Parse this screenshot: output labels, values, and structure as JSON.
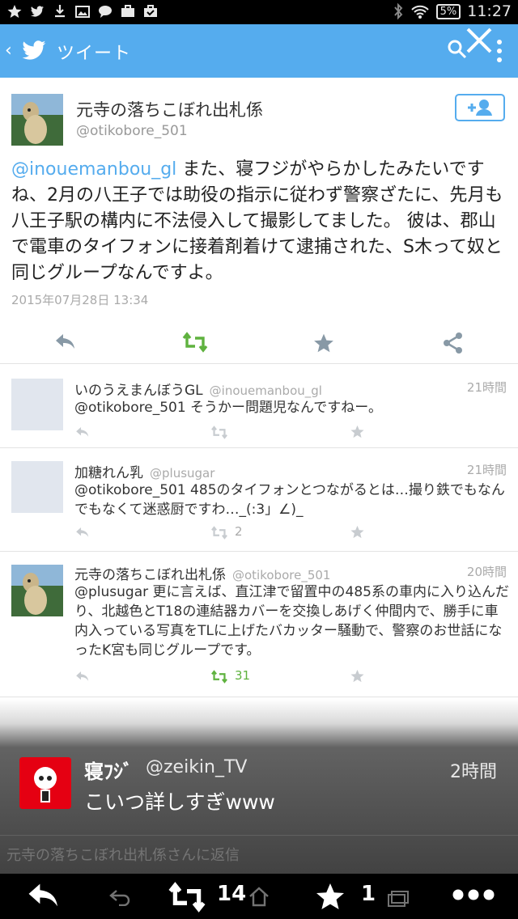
{
  "status_bar": {
    "battery": "5%",
    "time": "11:27",
    "left_icons": [
      "star-icon",
      "twitter-icon",
      "download-icon",
      "image-icon",
      "chat-icon",
      "briefcase-icon",
      "briefcase-check-icon"
    ],
    "right_icons": [
      "bluetooth-icon",
      "wifi-icon",
      "battery-icon"
    ]
  },
  "header": {
    "title": "ツイート",
    "color": "#55acee"
  },
  "main_tweet": {
    "name": "元寺の落ちこぼれ出札係",
    "handle": "@otikobore_501",
    "mention": "@inouemanbou_gl",
    "text": " また、寝フジがやらかしたみたいですね、2月の八王子では助役の指示に従わず警察ざたに、先月も八王子駅の構内に不法侵入して撮影してました。 彼は、郡山で電車のタイフォンに接着剤着けて逮捕された、S木って奴と同じグループなんですよ。",
    "date": "2015年07月28日 13:34"
  },
  "replies": [
    {
      "name": "いのうえまんぼうGL",
      "handle": "@inouemanbou_gl",
      "time": "21時間",
      "mention": "@otikobore_501",
      "text": " そうかー問題児なんですねー。",
      "retweets": ""
    },
    {
      "name": "加糖れん乳",
      "handle": "@plusugar",
      "time": "21時間",
      "mention": "@otikobore_501",
      "text": " 485のタイフォンとつながるとは…撮り鉄でもなんでもなくて迷惑厨ですわ…_(:3」∠)_",
      "retweets": "2"
    },
    {
      "name": "元寺の落ちこぼれ出札係",
      "handle": "@otikobore_501",
      "time": "20時間",
      "mention": "@plusugar",
      "text": " 更に言えば、直江津で留置中の485系の車内に入り込んだり、北越色とT18の連結器カバーを交換しあげく仲間内で、勝手に車内入っている写真をTLに上げたバカッター騒動で、警察のお世話になったK宮も同じグループです。",
      "retweets": "31"
    }
  ],
  "notification": {
    "name": "寝ﾌｼﾞ",
    "handle": "@zeikin_TV",
    "time": "2時間",
    "text": "こいつ詳しすぎwww",
    "reply_placeholder": "元寺の落ちこぼれ出札係さんに返信"
  },
  "bottom_bar": {
    "retweet_count": "14",
    "favorite_count": "1"
  }
}
